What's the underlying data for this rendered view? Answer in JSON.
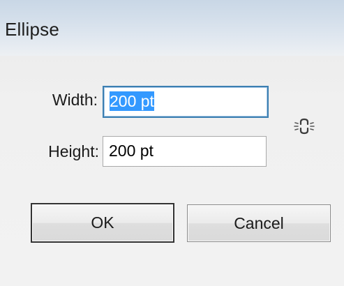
{
  "dialog": {
    "title": "Ellipse"
  },
  "fields": {
    "width": {
      "label": "Width:",
      "value": "200 pt",
      "selected": true
    },
    "height": {
      "label": "Height:",
      "value": "200 pt"
    }
  },
  "link": {
    "icon": "chain-link-icon",
    "constrained": false
  },
  "buttons": {
    "ok_label": "OK",
    "cancel_label": "Cancel"
  },
  "colors": {
    "selection": "#3399ff",
    "focus_border": "#3c7fb1",
    "default_button_border": "#333333"
  }
}
